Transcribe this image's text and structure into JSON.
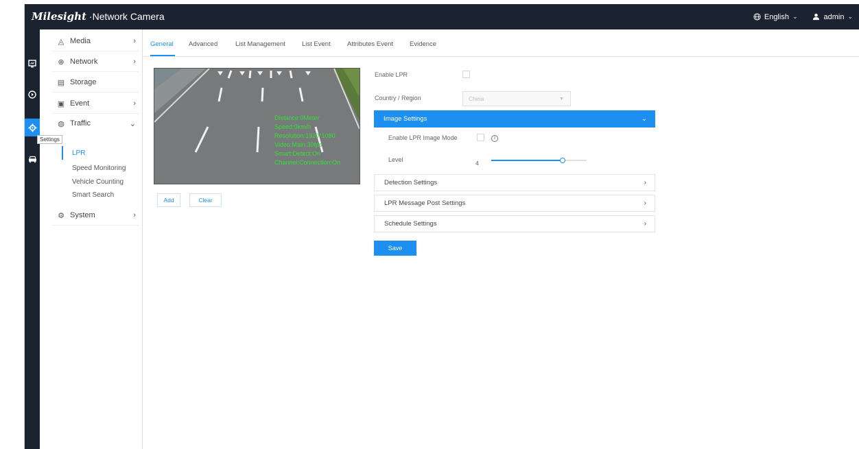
{
  "header": {
    "brand_logo": "Milesight",
    "brand_title": "Network Camera",
    "language_label": "English",
    "user_label": "admin"
  },
  "rail": {
    "items": [
      {
        "icon": "monitor-icon"
      },
      {
        "icon": "playback-icon"
      },
      {
        "icon": "settings-icon",
        "active": true
      },
      {
        "icon": "vehicle-icon"
      }
    ],
    "tooltip": "Settings"
  },
  "menu": {
    "items": [
      {
        "label": "Media",
        "icon": "media-icon"
      },
      {
        "label": "Network",
        "icon": "network-icon"
      },
      {
        "label": "Storage",
        "icon": "storage-icon"
      },
      {
        "label": "Event",
        "icon": "event-icon"
      },
      {
        "label": "Traffic",
        "icon": "traffic-icon"
      },
      {
        "label": "System",
        "icon": "system-icon"
      }
    ],
    "traffic_sub": [
      "LPR",
      "Speed Monitoring",
      "Vehicle Counting",
      "Smart Search"
    ]
  },
  "tabs": [
    "General",
    "Advanced",
    "List Management",
    "List Event",
    "Attributes Event",
    "Evidence"
  ],
  "preview": {
    "overlay_lines": [
      "Distance:0Meter",
      "Speed:0km/h",
      "Resolution:1920*1080",
      "Video:Main:30fps",
      "Smart:Detect:On",
      "Channel:Connection:On"
    ],
    "add_label": "Add",
    "clear_label": "Clear"
  },
  "form": {
    "enable_lpr_label": "Enable LPR",
    "country_label": "Country / Region",
    "country_value": "China",
    "image_settings_label": "Image Settings",
    "enable_lpr_image_mode_label": "Enable LPR Image Mode",
    "level_label": "Level",
    "level_value": "4",
    "level_fraction": 0.75,
    "detection_settings_label": "Detection Settings",
    "lpr_message_post_label": "LPR Message Post Settings",
    "schedule_settings_label": "Schedule Settings",
    "save_label": "Save"
  },
  "colors": {
    "accent": "#1c8ff1",
    "header_bg": "#1c2330",
    "overlay_text": "#34e03c"
  }
}
